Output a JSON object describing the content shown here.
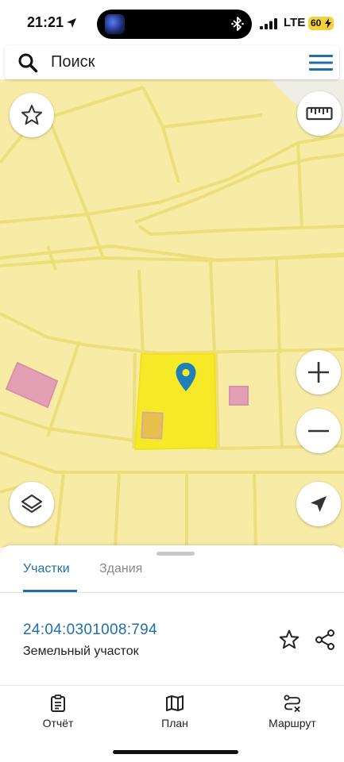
{
  "status_bar": {
    "time": "21:21",
    "network": "LTE",
    "battery": "60"
  },
  "search": {
    "placeholder": "Поиск"
  },
  "map": {
    "background_color": "#f7eba6",
    "boundary_color": "#ecdf7a",
    "selected_parcel_color": "#f6ea28",
    "building_color": "#df9ab0",
    "pin_color": "#1f7fb8",
    "controls": [
      "star-icon",
      "ruler-icon",
      "plus-icon",
      "minus-icon",
      "layers-icon",
      "navigation-arrow-icon"
    ]
  },
  "sheet": {
    "tabs": [
      {
        "label": "Участки",
        "active": true
      },
      {
        "label": "Здания",
        "active": false
      }
    ],
    "parcel": {
      "cadastral_number": "24:04:0301008:794",
      "type": "Земельный участок"
    }
  },
  "bottom_nav": {
    "items": [
      {
        "label": "Отчёт",
        "icon": "report-icon"
      },
      {
        "label": "План",
        "icon": "map-plan-icon"
      },
      {
        "label": "Маршрут",
        "icon": "route-icon"
      }
    ]
  },
  "colors": {
    "accent": "#1f6fa8",
    "muted": "#8a8a8a"
  }
}
